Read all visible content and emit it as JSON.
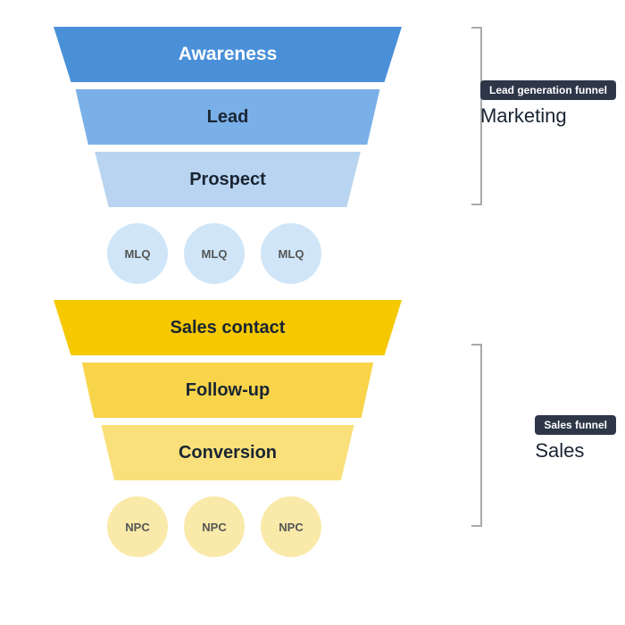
{
  "funnel": {
    "marketing": {
      "badge": "Lead generation funnel",
      "label": "Marketing",
      "layers": [
        {
          "id": "awareness",
          "text": "Awareness"
        },
        {
          "id": "lead",
          "text": "Lead"
        },
        {
          "id": "prospect",
          "text": "Prospect"
        }
      ],
      "circles": [
        {
          "id": "mlq1",
          "text": "MLQ"
        },
        {
          "id": "mlq2",
          "text": "MLQ"
        },
        {
          "id": "mlq3",
          "text": "MLQ"
        }
      ]
    },
    "sales": {
      "badge": "Sales funnel",
      "label": "Sales",
      "layers": [
        {
          "id": "salescontact",
          "text": "Sales contact"
        },
        {
          "id": "followup",
          "text": "Follow-up"
        },
        {
          "id": "conversion",
          "text": "Conversion"
        }
      ],
      "circles": [
        {
          "id": "npc1",
          "text": "NPC"
        },
        {
          "id": "npc2",
          "text": "NPC"
        },
        {
          "id": "npc3",
          "text": "NPC"
        }
      ]
    }
  }
}
